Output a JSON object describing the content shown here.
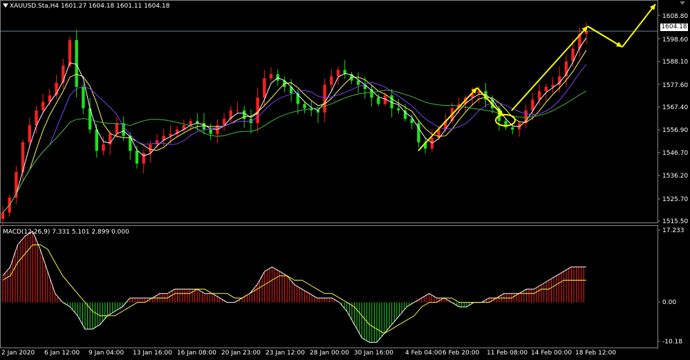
{
  "title": "XAUUSD.Sta,H4  1601.27 1604.18 1601.11 1604.18",
  "macd_title": "MACD(12,26,9) 7.331 5.101 2.899 0.000",
  "current_price": "1604.18",
  "colors": {
    "bull": "#ff2020",
    "bear": "#20e020",
    "ma_fast": "#ffffff",
    "ma_mid": "#ffff60",
    "ma_slow": "#8040ff",
    "ma_long": "#40c040",
    "signal": "#ffff40",
    "macd_line": "#ffffff",
    "annot": "#ffff00"
  },
  "price_axis": {
    "ticks": [
      "1608.80",
      "1598.60",
      "1588.10",
      "1577.60",
      "1567.40",
      "1556.90",
      "1546.70",
      "1536.20",
      "1525.70",
      "1515.50"
    ]
  },
  "macd_axis": {
    "ticks": [
      "17.233",
      "0.00",
      "-10.18"
    ]
  },
  "time_axis": {
    "ticks": [
      "2 Jan 2020",
      "6 Jan 12:00",
      "9 Jan 04:00",
      "13 Jan 16:00",
      "16 Jan 08:00",
      "20 Jan 23:00",
      "23 Jan 12:00",
      "28 Jan 00:00",
      "30 Jan 16:00",
      "4 Feb 04:00",
      "6 Feb 20:00",
      "11 Feb 08:00",
      "14 Feb 00:00",
      "18 Feb 12:00"
    ]
  },
  "chart_data": [
    {
      "type": "candlestick",
      "title": "XAUUSD.Sta,H4",
      "ylim": [
        1514,
        1613
      ],
      "last_close": 1604.18,
      "series": [
        {
          "name": "XAUUSD.Sta close (approx.)",
          "values": [
            1519,
            1526,
            1538,
            1552,
            1560,
            1567,
            1571,
            1574,
            1580,
            1588,
            1600,
            1578,
            1568,
            1558,
            1548,
            1551,
            1556,
            1561,
            1555,
            1548,
            1542,
            1547,
            1551,
            1553,
            1555,
            1556,
            1558,
            1560,
            1562,
            1561,
            1558,
            1556,
            1560,
            1563,
            1567,
            1567,
            1563,
            1561,
            1573,
            1582,
            1584,
            1581,
            1578,
            1575,
            1570,
            1568,
            1567,
            1566,
            1579,
            1583,
            1586,
            1584,
            1581,
            1579,
            1577,
            1573,
            1570,
            1574,
            1568,
            1567,
            1563,
            1561,
            1552,
            1549,
            1554,
            1558,
            1562,
            1568,
            1570,
            1573,
            1575,
            1576,
            1572,
            1568,
            1562,
            1559,
            1558,
            1561,
            1567,
            1572,
            1576,
            1578,
            1579,
            1583,
            1590,
            1596,
            1603,
            1604.18
          ]
        }
      ]
    },
    {
      "type": "line",
      "title": "MACD(12,26,9)",
      "ylim": [
        -10.18,
        17.233
      ],
      "macd": 7.331,
      "signal": 5.101,
      "histogram": 2.899,
      "series": [
        {
          "name": "MACD",
          "values": [
            6,
            8,
            13,
            15,
            16,
            12,
            7,
            2,
            0,
            -1,
            -3,
            -6,
            -6,
            -5,
            -3,
            -2,
            -1,
            1,
            1,
            1,
            1,
            2,
            2,
            3,
            3,
            3,
            3,
            2,
            2,
            1,
            0,
            0,
            1,
            2,
            4,
            7,
            8,
            7,
            6,
            4,
            3,
            2,
            1,
            1,
            1,
            0,
            -2,
            -5,
            -8,
            -9,
            -9,
            -7,
            -5,
            -3,
            -1,
            0,
            1,
            2,
            1,
            1,
            0,
            -1,
            -1,
            0,
            0,
            1,
            1,
            2,
            2,
            2,
            3,
            3,
            4,
            5,
            6,
            7,
            8,
            8,
            8
          ]
        },
        {
          "name": "Signal",
          "values": [
            5,
            6,
            9,
            11,
            13,
            13,
            12,
            9,
            6,
            4,
            2,
            0,
            -2,
            -3,
            -3,
            -3,
            -2,
            -1,
            0,
            0,
            1,
            1,
            1,
            2,
            2,
            2,
            3,
            3,
            2,
            2,
            2,
            1,
            1,
            2,
            3,
            4,
            5,
            6,
            6,
            5,
            5,
            4,
            3,
            2,
            2,
            1,
            0,
            -1,
            -3,
            -5,
            -6,
            -7,
            -6,
            -5,
            -4,
            -3,
            -1,
            0,
            0,
            1,
            1,
            0,
            0,
            0,
            0,
            0,
            1,
            1,
            1,
            2,
            2,
            2,
            3,
            3,
            4,
            5,
            5,
            5,
            5
          ]
        }
      ]
    }
  ]
}
